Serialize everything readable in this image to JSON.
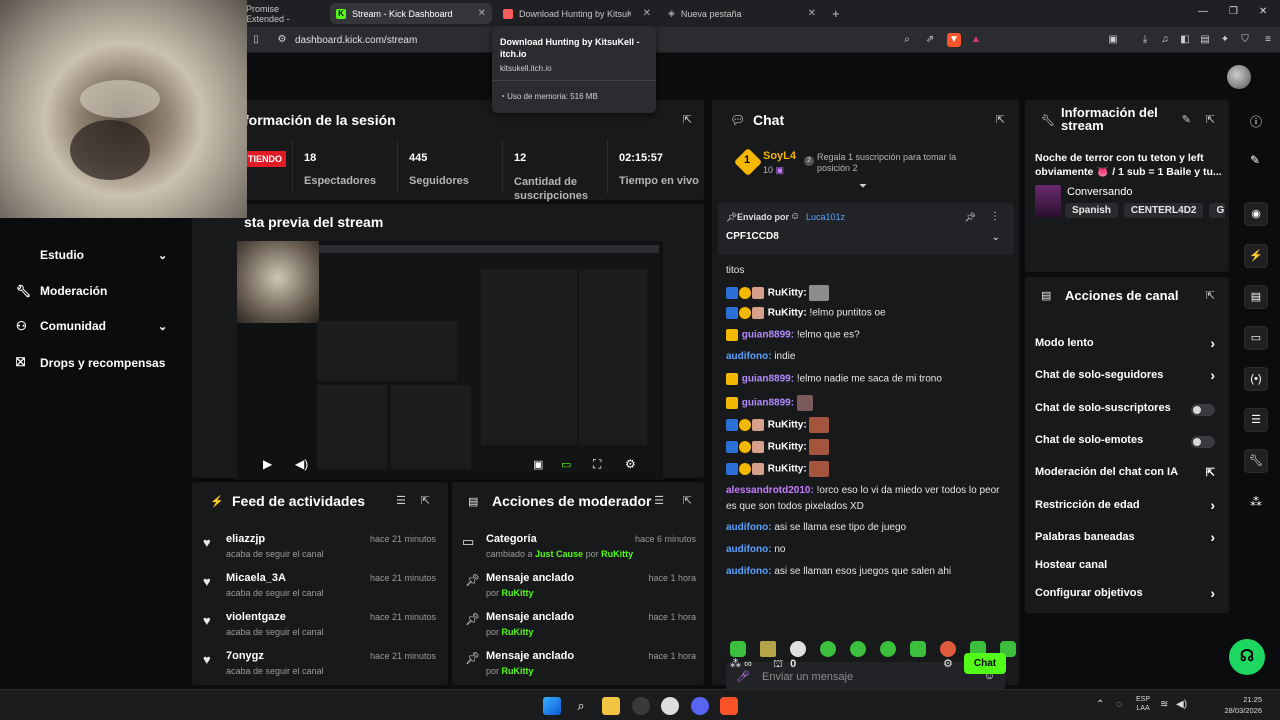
{
  "browser": {
    "tabs": [
      {
        "label": "Promise Extended -"
      },
      {
        "label": "Stream - Kick Dashboard",
        "active": true
      },
      {
        "label": "Download Hunting by KitsuKell"
      },
      {
        "label": "Nueva pestaña"
      }
    ],
    "new_tab": "+",
    "url": "dashboard.kick.com/stream",
    "tooltip": {
      "title": "Download Hunting by KitsuKell - itch.io",
      "domain": "kitsukell.itch.io",
      "memory": "Uso de memoria: 516 MB"
    }
  },
  "sidebar": {
    "items": [
      {
        "label": "Estudio"
      },
      {
        "label": "Moderación"
      },
      {
        "label": "Comunidad"
      },
      {
        "label": "Drops y recompensas"
      }
    ]
  },
  "session": {
    "title": "formación de la sesión",
    "live_badge": "TIENDO",
    "stats": [
      {
        "value": "18",
        "label": "Espectadores"
      },
      {
        "value": "445",
        "label": "Seguidores"
      },
      {
        "value": "12",
        "label": "Cantidad de suscripciones"
      },
      {
        "value": "02:15:57",
        "label": "Tiempo en vivo"
      }
    ]
  },
  "preview": {
    "title": "sta previa del stream"
  },
  "feed": {
    "title": "Feed de actividades",
    "rows": [
      {
        "user": "eliazzjp",
        "action": "acaba de seguir el canal",
        "time": "hace 21 minutos"
      },
      {
        "user": "Micaela_3A",
        "action": "acaba de seguir el canal",
        "time": "hace 21 minutos"
      },
      {
        "user": "violentgaze",
        "action": "acaba de seguir el canal",
        "time": "hace 21 minutos"
      },
      {
        "user": "7onygz",
        "action": "acaba de seguir el canal",
        "time": "hace 21 minutos"
      }
    ]
  },
  "modactions": {
    "title": "Acciones de moderador",
    "rows": [
      {
        "title": "Categoría",
        "pre": "cambiado a ",
        "hl": "Just Cause",
        "mid": " por ",
        "by": "RuKitty",
        "time": "hace 6 minutos"
      },
      {
        "title": "Mensaje anclado",
        "pre": "por ",
        "hl": "",
        "mid": "",
        "by": "RuKitty",
        "time": "hace 1 hora"
      },
      {
        "title": "Mensaje anclado",
        "pre": "por ",
        "hl": "",
        "mid": "",
        "by": "RuKitty",
        "time": "hace 1 hora"
      },
      {
        "title": "Mensaje anclado",
        "pre": "por ",
        "hl": "",
        "mid": "",
        "by": "RuKitty",
        "time": "hace 1 hora"
      }
    ]
  },
  "chat": {
    "title": "Chat",
    "top_gifter": {
      "rank": "1",
      "name": "SoyL4",
      "count": "10"
    },
    "gift_prompt_rank": "2",
    "gift_prompt": "Regala 1 suscripción para tomar la posición 2",
    "pinned_by_label": "Enviado por",
    "pinned_by": "Luca101z",
    "pinned_text": "CPF1CCD8",
    "messages": [
      {
        "user": "",
        "text": "titos",
        "color": "#e6e6e6"
      },
      {
        "user": "RuKitty:",
        "text": "",
        "color": "#ffffff"
      },
      {
        "user": "RuKitty:",
        "text": "!elmo puntitos oe",
        "color": "#ffffff"
      },
      {
        "user": "guian8899:",
        "text": "!elmo que es?",
        "color": "#b48cff"
      },
      {
        "user": "audifono:",
        "text": "indie",
        "color": "#5aa2ff"
      },
      {
        "user": "guian8899:",
        "text": "!elmo nadie me saca de mi trono",
        "color": "#b48cff"
      },
      {
        "user": "guian8899:",
        "text": "",
        "color": "#b48cff"
      },
      {
        "user": "RuKitty:",
        "text": "",
        "color": "#ffffff"
      },
      {
        "user": "RuKitty:",
        "text": "",
        "color": "#ffffff"
      },
      {
        "user": "RuKitty:",
        "text": "",
        "color": "#ffffff"
      },
      {
        "user": "alessandrotd2010:",
        "text": "!orco eso lo vi da miedo ver todos lo peor",
        "color": "#c77dff"
      },
      {
        "user": "",
        "text": "es que son todos pixelados XD",
        "color": "#e6e6e6"
      },
      {
        "user": "audifono:",
        "text": "asi se llama ese tipo de juego",
        "color": "#5aa2ff"
      },
      {
        "user": "audifono:",
        "text": "no",
        "color": "#5aa2ff"
      },
      {
        "user": "audifono:",
        "text": "asi se llaman esos juegos que salen ahi",
        "color": "#5aa2ff"
      }
    ],
    "input_placeholder": "Enviar un mensaje",
    "points": "0",
    "send_label": "Chat"
  },
  "stream_info": {
    "title": "Información del stream",
    "stream_title": "Noche de terror con tu teton y left obviamente 👅 / 1 sub = 1 Baile y tu...",
    "category": "Conversando",
    "tags": [
      "Spanish",
      "CENTERL4D2",
      "G"
    ]
  },
  "channel_actions": {
    "title": "Acciones de canal",
    "rows": [
      {
        "label": "Modo lento",
        "control": "chevron"
      },
      {
        "label": "Chat de solo-seguidores",
        "control": "chevron"
      },
      {
        "label": "Chat de solo-suscriptores",
        "control": "toggle"
      },
      {
        "label": "Chat de solo-emotes",
        "control": "toggle"
      },
      {
        "label": "Moderación del chat con IA",
        "control": "external"
      },
      {
        "label": "Restricción de edad",
        "control": "chevron"
      },
      {
        "label": "Palabras baneadas",
        "control": "chevron"
      },
      {
        "label": "Hostear canal",
        "control": "none"
      },
      {
        "label": "Configurar objetivos",
        "control": "chevron"
      }
    ]
  },
  "taskbar": {
    "lang": "ESP",
    "lang2": "LAA",
    "time": "21:25",
    "date": "28/03/2026"
  },
  "colors": {
    "accent": "#53fc18",
    "panel": "#18191b",
    "bg": "#0b0c0d",
    "live": "#e01b24"
  }
}
